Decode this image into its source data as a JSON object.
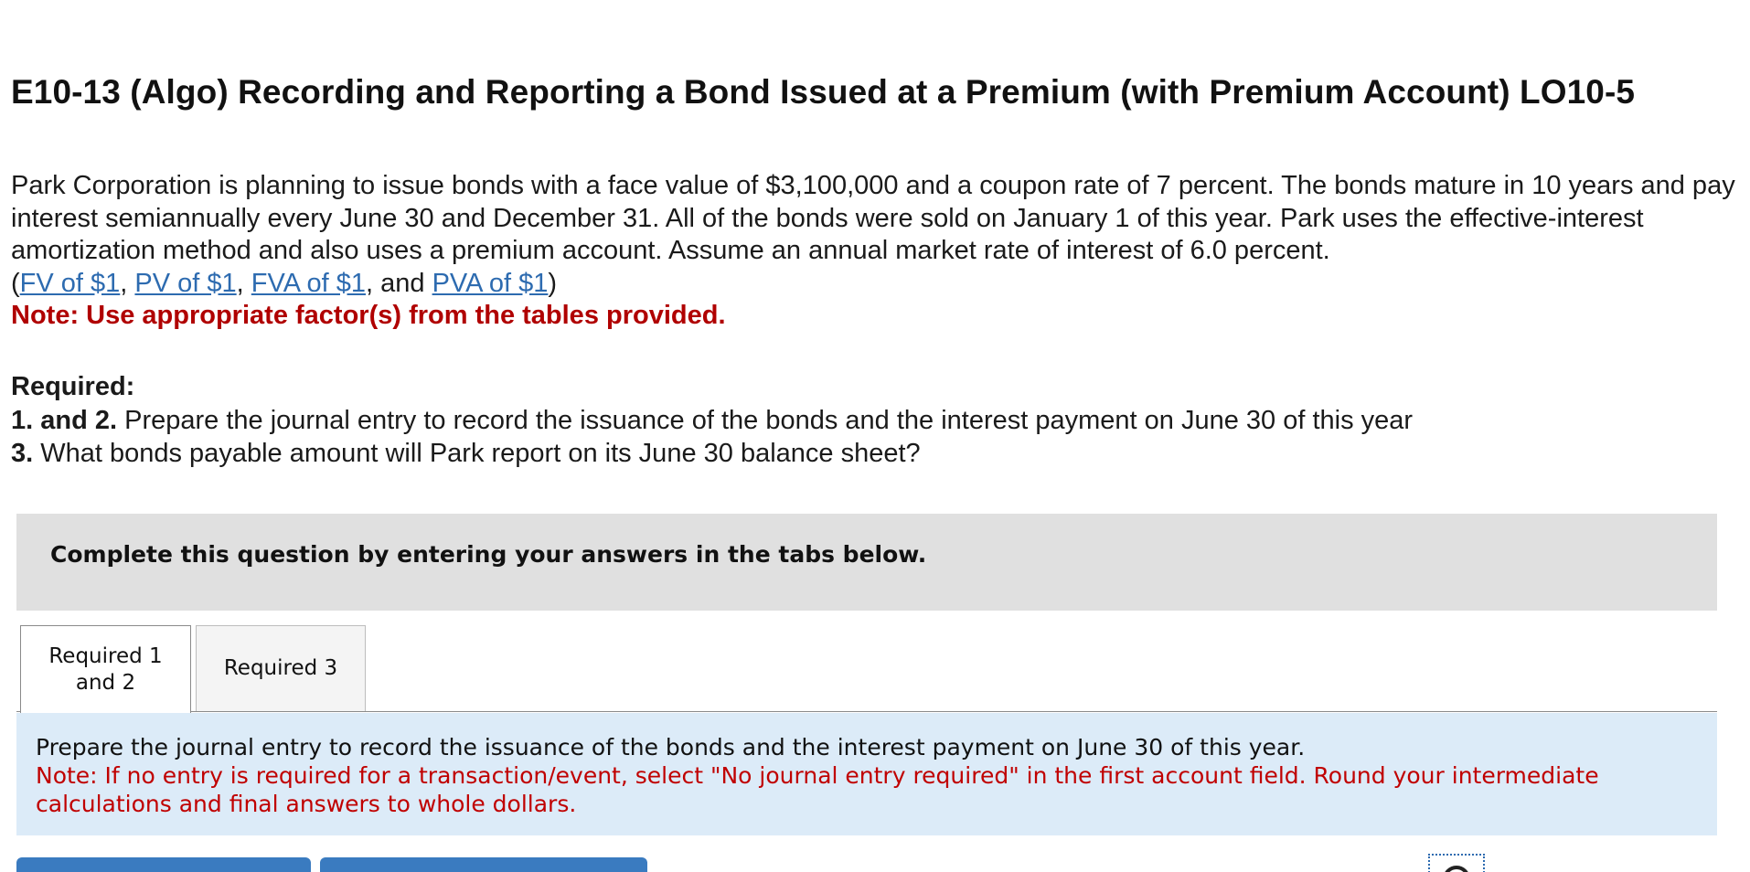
{
  "header": {
    "title": "E10-13 (Algo) Recording and Reporting a Bond Issued at a Premium (with Premium Account) LO10-5"
  },
  "problem": {
    "text": "Park Corporation is planning to issue bonds with a face value of $3,100,000 and a coupon rate of 7 percent. The bonds mature in 10 years and pay interest semiannually every June 30 and December 31. All of the bonds were sold on January 1 of this year. Park uses the effective-interest amortization method and also uses a premium account. Assume an annual market rate of interest of 6.0 percent.",
    "open_paren": "(",
    "links": {
      "fv": "FV of $1",
      "pv": "PV of $1",
      "fva": "FVA of $1",
      "pva": "PVA of $1"
    },
    "sep_comma": ", ",
    "sep_and": ", and ",
    "close_paren": ")",
    "note": "Note: Use appropriate factor(s) from the tables provided."
  },
  "required": {
    "heading": "Required:",
    "item1_label": "1. and 2.",
    "item1_text": " Prepare the journal entry to record the issuance of the bonds and the interest payment on June 30 of this year",
    "item3_label": "3.",
    "item3_text": " What bonds payable amount will Park report on its June 30 balance sheet?"
  },
  "banner": {
    "text": "Complete this question by entering your answers in the tabs below."
  },
  "tabs": [
    {
      "label_line1": "Required 1",
      "label_line2": "and 2",
      "active": true
    },
    {
      "label": "Required 3",
      "active": false
    }
  ],
  "instructions": {
    "main": "Prepare the journal entry to record the issuance of the bonds and the interest payment on June 30 of this year.",
    "note": "Note: If no entry is required for a transaction/event, select \"No journal entry required\" in the first account field. Round your intermediate calculations and final answers to whole dollars."
  },
  "colors": {
    "link": "#2d6bb0",
    "note_red": "#b00000",
    "banner_bg": "#e0e0e0",
    "instructions_bg": "#dcebf8",
    "button_blue": "#3a7bc0"
  },
  "icons": {
    "help": "help-icon"
  }
}
